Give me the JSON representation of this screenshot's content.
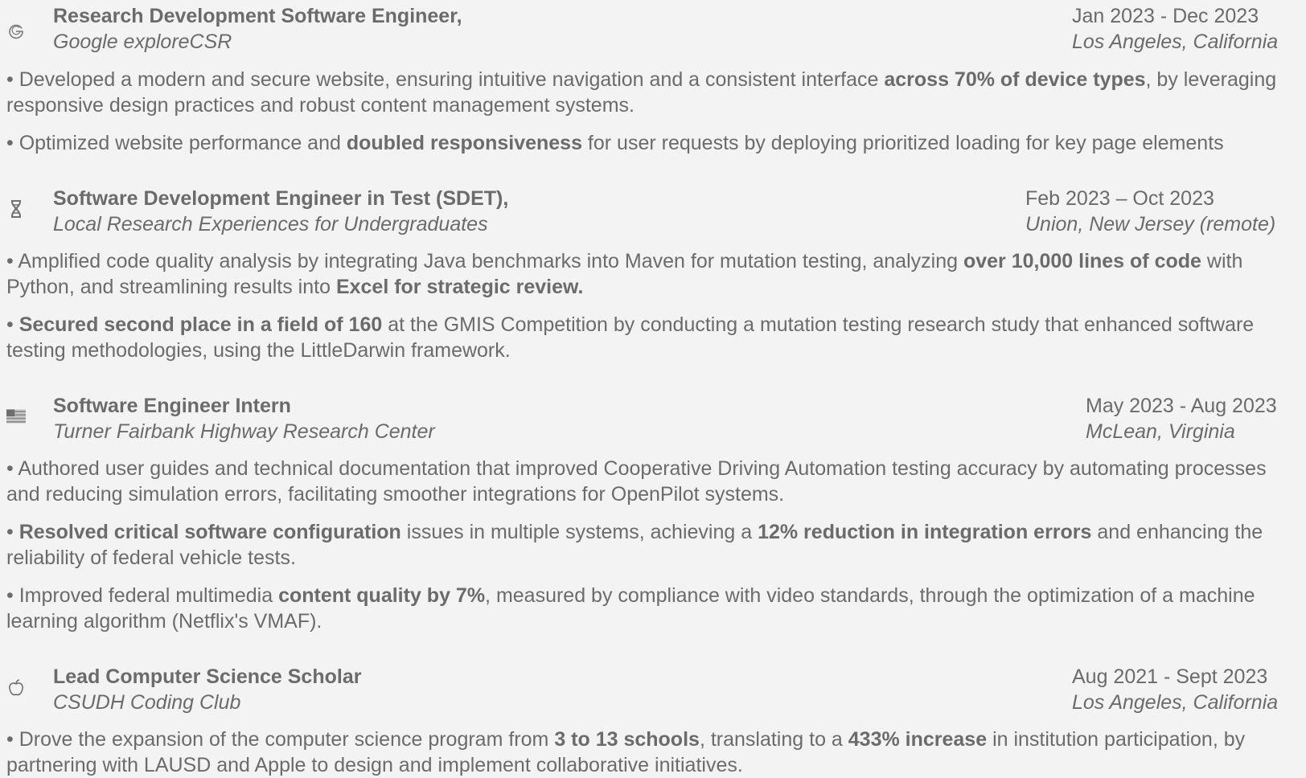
{
  "entries": [
    {
      "logo": "google-icon",
      "title": "Research Development Software Engineer,",
      "org": "Google exploreCSR",
      "dates": "Jan 2023 - Dec 2023",
      "location": "Los Angeles, California",
      "bullets": [
        [
          {
            "t": "• Developed a modern and secure website, ensuring intuitive navigation and a consistent interface ",
            "b": false
          },
          {
            "t": "across 70% of device types",
            "b": true
          },
          {
            "t": ", by leveraging responsive design practices and robust content management systems.",
            "b": false
          }
        ],
        [
          {
            "t": "• Optimized website performance and ",
            "b": false
          },
          {
            "t": "doubled responsiveness",
            "b": true
          },
          {
            "t": " for user requests by deploying prioritized loading for key page elements",
            "b": false
          }
        ]
      ]
    },
    {
      "logo": "dna-icon",
      "title": "Software Development Engineer in Test (SDET),",
      "org": "Local Research Experiences for Undergraduates",
      "dates": "Feb 2023 – Oct 2023",
      "location": "Union, New Jersey (remote)",
      "bullets": [
        [
          {
            "t": "• Amplified code quality analysis by integrating Java benchmarks into Maven for mutation testing, analyzing ",
            "b": false
          },
          {
            "t": "over 10,000 lines of code",
            "b": true
          },
          {
            "t": " with Python, and streamlining results into ",
            "b": false
          },
          {
            "t": "Excel for strategic review.",
            "b": true
          }
        ],
        [
          {
            "t": "• ",
            "b": false
          },
          {
            "t": "Secured second place in a field of 160",
            "b": true
          },
          {
            "t": " at the GMIS Competition by conducting a mutation testing research study that enhanced software testing methodologies, using the LittleDarwin framework.",
            "b": false
          }
        ]
      ]
    },
    {
      "logo": "us-flag-icon",
      "title": "Software Engineer Intern",
      "org": "Turner Fairbank Highway Research Center",
      "dates": "May 2023 - Aug 2023",
      "location": "McLean, Virginia",
      "bullets": [
        [
          {
            "t": "• Authored user guides and technical documentation that improved Cooperative Driving Automation testing accuracy by automating processes and reducing simulation errors, facilitating smoother integrations for OpenPilot systems.",
            "b": false
          }
        ],
        [
          {
            "t": "• ",
            "b": false
          },
          {
            "t": "Resolved critical software configuration",
            "b": true
          },
          {
            "t": " issues in multiple systems, achieving a ",
            "b": false
          },
          {
            "t": "12% reduction in integration errors",
            "b": true
          },
          {
            "t": " and enhancing the reliability of federal vehicle tests.",
            "b": false
          }
        ],
        [
          {
            "t": "• Improved federal multimedia ",
            "b": false
          },
          {
            "t": "content quality by 7%",
            "b": true
          },
          {
            "t": ", measured by compliance with video standards, through the optimization of a machine learning algorithm (Netflix's VMAF).",
            "b": false
          }
        ]
      ]
    },
    {
      "logo": "apple-icon",
      "title": "Lead Computer Science Scholar",
      "org": "CSUDH Coding Club",
      "dates": "Aug 2021 - Sept 2023",
      "location": "Los Angeles, California",
      "bullets": [
        [
          {
            "t": "• Drove the expansion of the computer science program from ",
            "b": false
          },
          {
            "t": "3 to 13 schools",
            "b": true
          },
          {
            "t": ", translating to a ",
            "b": false
          },
          {
            "t": "433% increase",
            "b": true
          },
          {
            "t": " in institution participation, by partnering with LAUSD and Apple to design and implement collaborative initiatives.",
            "b": false
          }
        ]
      ]
    }
  ]
}
